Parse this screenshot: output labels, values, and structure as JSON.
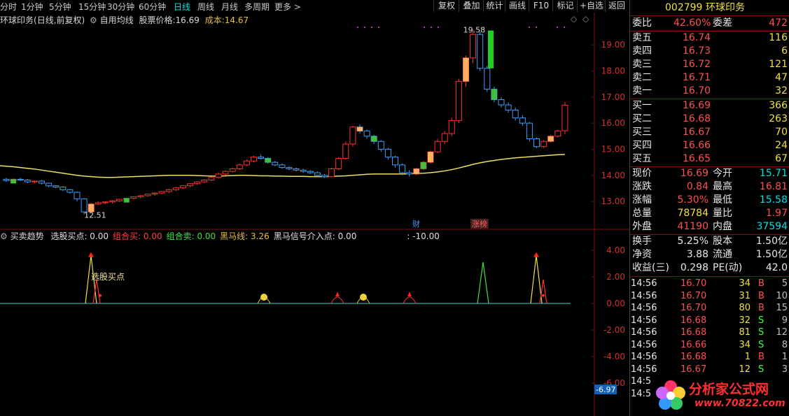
{
  "toolbar": {
    "periods": [
      "分时",
      "1分钟",
      "5分钟",
      "15分钟",
      "30分钟",
      "60分钟",
      "日线",
      "周线",
      "月线",
      "多周期",
      "更多 >"
    ],
    "active_period": "日线",
    "buttons": [
      "复权",
      "叠加",
      "统计",
      "画线",
      "F10",
      "标记",
      "+自选",
      "返回"
    ]
  },
  "info": {
    "stock": "环球印务",
    "mode": "(日线,前复权)",
    "ma_label": "自用均线",
    "price_label": "股票价格:",
    "price_value": "16.69",
    "cost_label": "成本:",
    "cost_value": "14.67"
  },
  "price_axis": [
    "19.00",
    "18.00",
    "17.00",
    "16.00",
    "15.00",
    "14.00",
    "13.00"
  ],
  "price_marks": {
    "high": "19.58",
    "low": "12.51"
  },
  "chart_tags": [
    "财",
    "涨榜"
  ],
  "indicator": {
    "name": "买卖趋势",
    "items": [
      {
        "label": "选股买点: 0.00",
        "color": "#e0e0e0"
      },
      {
        "label": "组合买: 0.00",
        "color": "#ff4040"
      },
      {
        "label": "组合卖: 0.00",
        "color": "#40e040"
      },
      {
        "label": "黑马线: 3.26",
        "color": "#e0c040"
      },
      {
        "label": "黑马信号介入点: 0.00",
        "color": "#e0e0e0"
      },
      {
        "label": ": -10.00",
        "color": "#e0e0e0"
      }
    ],
    "axis": [
      "4.00",
      "2.00",
      "0.00",
      "-2.00",
      "-4.00",
      "-6.00"
    ],
    "cursor_value": "-6.97",
    "buy_point_text": "选股买点"
  },
  "quote": {
    "code": "002799",
    "name": "环球印务",
    "wei_bi_label": "委比",
    "wei_bi": "42.60%",
    "wei_cha_label": "委差",
    "wei_cha": "472",
    "sells": [
      {
        "label": "卖五",
        "price": "16.74",
        "vol": "116"
      },
      {
        "label": "卖四",
        "price": "16.73",
        "vol": "6"
      },
      {
        "label": "卖三",
        "price": "16.72",
        "vol": "121"
      },
      {
        "label": "卖二",
        "price": "16.71",
        "vol": "47"
      },
      {
        "label": "卖一",
        "price": "16.70",
        "vol": "32"
      }
    ],
    "buys": [
      {
        "label": "买一",
        "price": "16.69",
        "vol": "366"
      },
      {
        "label": "买二",
        "price": "16.68",
        "vol": "263"
      },
      {
        "label": "买三",
        "price": "16.67",
        "vol": "70"
      },
      {
        "label": "买四",
        "price": "16.66",
        "vol": "24"
      },
      {
        "label": "买五",
        "price": "16.65",
        "vol": "67"
      }
    ],
    "stats": [
      {
        "l1": "现价",
        "v1": "16.69",
        "c1": "red",
        "l2": "今开",
        "v2": "15.71",
        "c2": "cyan"
      },
      {
        "l1": "涨跌",
        "v1": "0.84",
        "c1": "red",
        "l2": "最高",
        "v2": "16.81",
        "c2": "red"
      },
      {
        "l1": "涨幅",
        "v1": "5.30%",
        "c1": "red",
        "l2": "最低",
        "v2": "15.58",
        "c2": "cyan"
      },
      {
        "l1": "总量",
        "v1": "78784",
        "c1": "yellow",
        "l2": "量比",
        "v2": "1.97",
        "c2": "red"
      },
      {
        "l1": "外盘",
        "v1": "41190",
        "c1": "red",
        "l2": "内盘",
        "v2": "37594",
        "c2": "cyan"
      }
    ],
    "stats2": [
      {
        "l1": "换手",
        "v1": "5.25%",
        "l2": "股本",
        "v2": "1.50亿"
      },
      {
        "l1": "净资",
        "v1": "3.88",
        "l2": "流通",
        "v2": "1.50亿"
      },
      {
        "l1": "收益(三)",
        "v1": "0.298",
        "l2": "PE(动)",
        "v2": "42.0"
      }
    ],
    "ticks": [
      {
        "time": "14:56",
        "price": "16.70",
        "vol": "34",
        "side": "B",
        "n": "5"
      },
      {
        "time": "14:56",
        "price": "16.70",
        "vol": "31",
        "side": "B",
        "n": "10"
      },
      {
        "time": "14:56",
        "price": "16.70",
        "vol": "80",
        "side": "B",
        "n": "15"
      },
      {
        "time": "14:56",
        "price": "16.68",
        "vol": "32",
        "side": "S",
        "n": "9"
      },
      {
        "time": "14:56",
        "price": "16.68",
        "vol": "81",
        "side": "S",
        "n": "12"
      },
      {
        "time": "14:56",
        "price": "16.66",
        "vol": "34",
        "side": "S",
        "n": "8"
      },
      {
        "time": "14:56",
        "price": "16.68",
        "vol": "1",
        "side": "B",
        "n": "1"
      },
      {
        "time": "14:56",
        "price": "16.67",
        "vol": "12",
        "side": "S",
        "n": "3"
      },
      {
        "time": "14:5",
        "price": "",
        "vol": "",
        "side": "",
        "n": ""
      },
      {
        "time": "14:5",
        "price": "",
        "vol": "",
        "side": "",
        "n": ""
      }
    ]
  },
  "watermark": {
    "title": "分析家公式网",
    "url": "www.70822.com"
  },
  "chart_data": {
    "type": "candlestick",
    "y_range": [
      12.5,
      19.7
    ],
    "candles": [
      [
        13.85,
        13.9,
        13.75,
        13.8
      ],
      [
        13.8,
        13.88,
        13.72,
        13.85
      ],
      [
        13.85,
        13.9,
        13.78,
        13.82
      ],
      [
        13.82,
        13.86,
        13.7,
        13.75
      ],
      [
        13.75,
        13.8,
        13.68,
        13.78
      ],
      [
        13.78,
        13.82,
        13.65,
        13.7
      ],
      [
        13.7,
        13.72,
        13.55,
        13.6
      ],
      [
        13.6,
        13.62,
        13.5,
        13.55
      ],
      [
        13.55,
        13.58,
        13.4,
        13.45
      ],
      [
        13.45,
        13.48,
        13.3,
        13.35
      ],
      [
        13.35,
        13.38,
        13.0,
        13.1
      ],
      [
        13.1,
        13.12,
        12.51,
        12.6
      ],
      [
        12.6,
        12.95,
        12.55,
        12.9
      ],
      [
        12.9,
        13.0,
        12.85,
        12.95
      ],
      [
        12.95,
        13.0,
        12.9,
        12.98
      ],
      [
        12.98,
        13.05,
        12.92,
        13.02
      ],
      [
        13.02,
        13.1,
        12.98,
        13.08
      ],
      [
        13.08,
        13.15,
        13.05,
        13.12
      ],
      [
        13.12,
        13.2,
        13.08,
        13.18
      ],
      [
        13.18,
        13.25,
        13.12,
        13.22
      ],
      [
        13.22,
        13.3,
        13.18,
        13.28
      ],
      [
        13.28,
        13.35,
        13.22,
        13.32
      ],
      [
        13.32,
        13.4,
        13.28,
        13.38
      ],
      [
        13.38,
        13.48,
        13.32,
        13.45
      ],
      [
        13.45,
        13.55,
        13.4,
        13.52
      ],
      [
        13.52,
        13.62,
        13.48,
        13.6
      ],
      [
        13.6,
        13.7,
        13.55,
        13.68
      ],
      [
        13.68,
        13.78,
        13.62,
        13.75
      ],
      [
        13.75,
        13.85,
        13.7,
        13.82
      ],
      [
        13.82,
        13.95,
        13.78,
        13.92
      ],
      [
        13.92,
        14.1,
        13.88,
        14.05
      ],
      [
        14.05,
        14.2,
        14.0,
        14.15
      ],
      [
        14.15,
        14.3,
        14.1,
        14.25
      ],
      [
        14.25,
        14.45,
        14.2,
        14.4
      ],
      [
        14.4,
        14.6,
        14.35,
        14.55
      ],
      [
        14.55,
        14.75,
        14.5,
        14.7
      ],
      [
        14.7,
        14.8,
        14.6,
        14.65
      ],
      [
        14.65,
        14.7,
        14.45,
        14.5
      ],
      [
        14.5,
        14.55,
        14.35,
        14.4
      ],
      [
        14.4,
        14.45,
        14.25,
        14.3
      ],
      [
        14.3,
        14.35,
        14.2,
        14.25
      ],
      [
        14.25,
        14.3,
        14.15,
        14.2
      ],
      [
        14.2,
        14.25,
        14.1,
        14.15
      ],
      [
        14.15,
        14.2,
        14.05,
        14.1
      ],
      [
        14.1,
        14.15,
        13.95,
        14.0
      ],
      [
        14.0,
        14.05,
        13.9,
        13.95
      ],
      [
        13.95,
        14.3,
        13.92,
        14.25
      ],
      [
        14.25,
        14.7,
        14.2,
        14.65
      ],
      [
        14.65,
        15.3,
        14.6,
        15.2
      ],
      [
        15.2,
        15.9,
        15.1,
        15.85
      ],
      [
        15.85,
        15.95,
        15.6,
        15.7
      ],
      [
        15.7,
        15.75,
        15.4,
        15.5
      ],
      [
        15.5,
        15.55,
        15.2,
        15.3
      ],
      [
        15.3,
        15.35,
        14.9,
        15.0
      ],
      [
        15.0,
        15.05,
        14.6,
        14.7
      ],
      [
        14.7,
        14.75,
        14.3,
        14.4
      ],
      [
        14.4,
        14.45,
        14.0,
        14.1
      ],
      [
        14.1,
        14.2,
        13.95,
        14.05
      ],
      [
        14.05,
        14.3,
        14.0,
        14.25
      ],
      [
        14.25,
        14.55,
        14.2,
        14.5
      ],
      [
        14.5,
        14.95,
        14.45,
        14.9
      ],
      [
        14.9,
        15.4,
        14.85,
        15.3
      ],
      [
        15.3,
        15.7,
        15.2,
        15.6
      ],
      [
        15.6,
        16.2,
        15.5,
        16.1
      ],
      [
        16.1,
        17.7,
        16.0,
        17.6
      ],
      [
        17.6,
        18.6,
        17.4,
        18.5
      ],
      [
        18.5,
        19.58,
        18.3,
        19.4
      ],
      [
        19.4,
        19.5,
        18.0,
        18.1
      ],
      [
        18.1,
        18.2,
        17.2,
        17.3
      ],
      [
        17.3,
        17.4,
        16.8,
        16.9
      ],
      [
        16.9,
        17.0,
        16.6,
        16.7
      ],
      [
        16.7,
        16.8,
        16.4,
        16.5
      ],
      [
        16.5,
        16.6,
        16.1,
        16.2
      ],
      [
        16.2,
        16.3,
        15.9,
        16.0
      ],
      [
        16.0,
        16.05,
        15.3,
        15.4
      ],
      [
        15.4,
        15.45,
        15.05,
        15.1
      ],
      [
        15.1,
        15.35,
        15.05,
        15.3
      ],
      [
        15.3,
        15.55,
        15.25,
        15.5
      ],
      [
        15.5,
        15.75,
        15.45,
        15.7
      ],
      [
        15.71,
        16.81,
        15.58,
        16.69
      ]
    ],
    "ma": [
      14.35,
      14.33,
      14.3,
      14.27,
      14.24,
      14.2,
      14.16,
      14.12,
      14.08,
      14.04,
      14.0,
      13.97,
      13.95,
      13.93,
      13.92,
      13.92,
      13.93,
      13.94,
      13.95,
      13.96,
      13.97,
      13.98,
      13.99,
      14.0,
      14.0,
      14.0,
      14.0,
      13.99,
      13.98,
      13.97,
      13.97,
      13.98,
      13.99,
      14.0,
      14.0,
      13.99,
      13.98,
      13.98,
      13.97,
      13.97,
      13.96,
      13.96,
      13.96,
      13.95,
      13.95,
      13.95,
      13.96,
      13.97,
      13.98,
      14.0,
      14.02,
      14.04,
      14.05,
      14.05,
      14.05,
      14.05,
      14.05,
      14.06,
      14.07,
      14.08,
      14.1,
      14.13,
      14.17,
      14.22,
      14.28,
      14.35,
      14.42,
      14.48,
      14.53,
      14.57,
      14.61,
      14.64,
      14.67,
      14.69,
      14.71,
      14.73,
      14.75,
      14.77,
      14.79,
      14.8
    ]
  }
}
